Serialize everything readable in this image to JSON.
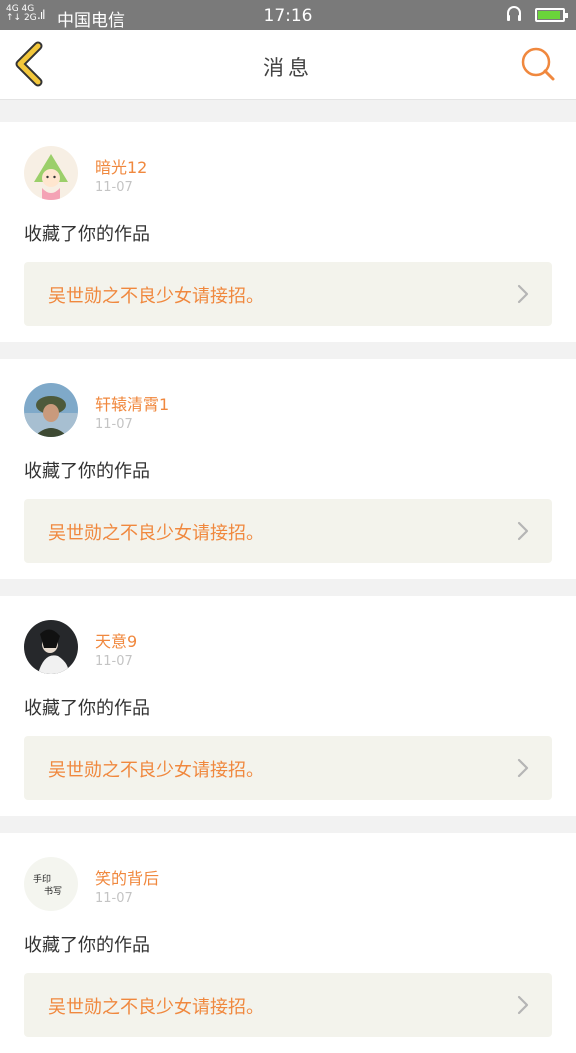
{
  "status": {
    "net_top": "4G 4G",
    "net_bottom": "↑↓ 2G",
    "carrier": "中国电信",
    "time": "17:16",
    "battery_level": 0.85,
    "battery_color": "#6ad43a"
  },
  "header": {
    "title": "消息",
    "back_icon": "chevron-left-icon",
    "search_icon": "search-icon",
    "accent": "#f0883e"
  },
  "messages": [
    {
      "username": "暗光12",
      "date": "11-07",
      "action": "收藏了你的作品",
      "work_title": "吴世勋之不良少女请接招。",
      "avatar": "cartoon-girl"
    },
    {
      "username": "轩辕清霄1",
      "date": "11-07",
      "action": "收藏了你的作品",
      "work_title": "吴世勋之不良少女请接招。",
      "avatar": "soldier-photo"
    },
    {
      "username": "天意9",
      "date": "11-07",
      "action": "收藏了你的作品",
      "work_title": "吴世勋之不良少女请接招。",
      "avatar": "costume-photo"
    },
    {
      "username": "笑的背后",
      "date": "11-07",
      "action": "收藏了你的作品",
      "work_title": "吴世勋之不良少女请接招。",
      "avatar": "calligraphy"
    }
  ]
}
